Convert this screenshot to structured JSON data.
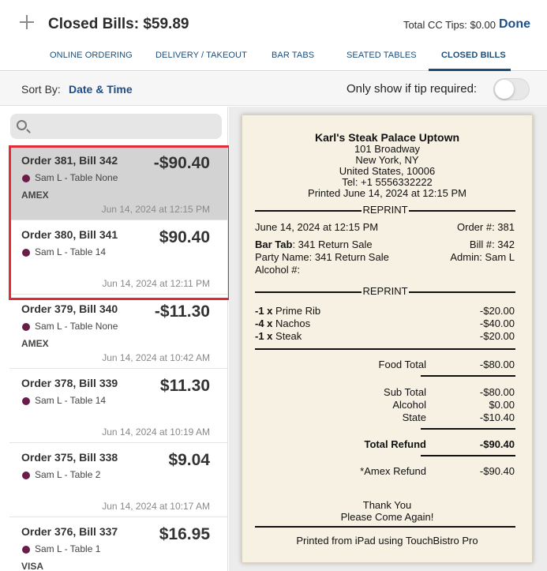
{
  "header": {
    "title": "Closed Bills: $59.89",
    "tips": "Total CC Tips: $0.00",
    "done_label": "Done"
  },
  "tabs": [
    {
      "label": "ONLINE ORDERING"
    },
    {
      "label": "DELIVERY / TAKEOUT"
    },
    {
      "label": "BAR TABS"
    },
    {
      "label": "SEATED TABLES"
    },
    {
      "label": "CLOSED BILLS",
      "active": true
    }
  ],
  "sort": {
    "label": "Sort By:",
    "value": "Date & Time",
    "tip_label": "Only show if tip required:",
    "tip_required": false
  },
  "search": {
    "placeholder": ""
  },
  "colors": {
    "accent": "#1d4e89",
    "server_dot": "#6b1d4a",
    "highlight": "#e12b36"
  },
  "bills": [
    {
      "order": "Order 381, Bill 342",
      "amount": "-$90.40",
      "server": "Sam L - Table None",
      "payment": "AMEX",
      "time": "Jun 14, 2024 at 12:15 PM",
      "selected": true
    },
    {
      "order": "Order 380, Bill 341",
      "amount": "$90.40",
      "server": "Sam L - Table 14",
      "payment": "",
      "time": "Jun 14, 2024 at 12:11 PM"
    },
    {
      "order": "Order 379, Bill 340",
      "amount": "-$11.30",
      "server": "Sam L - Table None",
      "payment": "AMEX",
      "time": "Jun 14, 2024 at 10:42 AM"
    },
    {
      "order": "Order 378, Bill 339",
      "amount": "$11.30",
      "server": "Sam L - Table 14",
      "payment": "",
      "time": "Jun 14, 2024 at 10:19 AM"
    },
    {
      "order": "Order 375, Bill 338",
      "amount": "$9.04",
      "server": "Sam L - Table 2",
      "payment": "",
      "time": "Jun 14, 2024 at 10:17 AM"
    },
    {
      "order": "Order 376, Bill 337",
      "amount": "$16.95",
      "server": "Sam L - Table 1",
      "payment": "VISA",
      "time": ""
    }
  ],
  "receipt": {
    "restaurant": "Karl's Steak Palace Uptown",
    "address1": "101 Broadway",
    "address2": "New York, NY",
    "address3": "United States, 10006",
    "phone": "Tel: +1 5556332222",
    "printed": "Printed June 14, 2024 at 12:15 PM",
    "reprint": "REPRINT",
    "date": "June 14, 2024 at 12:15 PM",
    "order_no": "Order #: 381",
    "bar_tab_label": "Bar Tab",
    "bar_tab_value": ": 341 Return Sale",
    "bill_no": "Bill #: 342",
    "party": "Party Name: 341 Return Sale",
    "admin": "Admin: Sam L",
    "alcohol_no": "Alcohol #:",
    "items": [
      {
        "qty": "-1 x",
        "name": " Prime Rib",
        "price": "-$20.00"
      },
      {
        "qty": "-4 x",
        "name": " Nachos",
        "price": "-$40.00"
      },
      {
        "qty": "-1 x",
        "name": " Steak",
        "price": "-$20.00"
      }
    ],
    "food_total_label": "Food Total",
    "food_total": "-$80.00",
    "subtotal_label": "Sub Total",
    "subtotal": "-$80.00",
    "alcohol_label": "Alcohol",
    "alcohol": "$0.00",
    "state_label": "State",
    "state": "-$10.40",
    "total_refund_label": "Total Refund",
    "total_refund": "-$90.40",
    "amex_refund_label": "*Amex Refund",
    "amex_refund": "-$90.40",
    "thanks1": "Thank You",
    "thanks2": "Please Come Again!",
    "footer": "Printed from iPad using TouchBistro Pro"
  }
}
